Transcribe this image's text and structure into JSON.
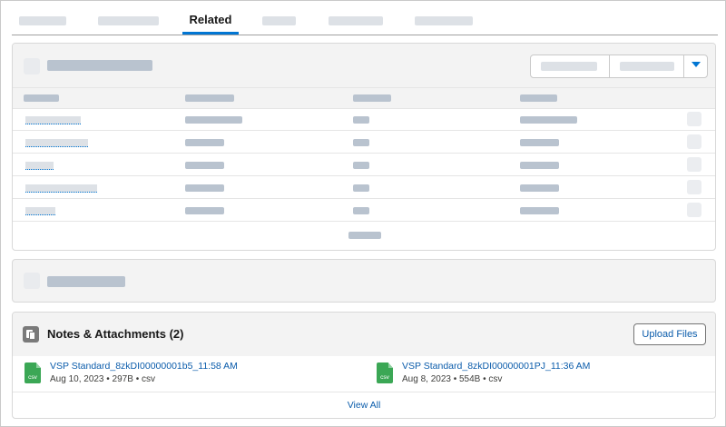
{
  "tabs": {
    "active_label": "Related"
  },
  "notes": {
    "title": "Notes & Attachments (2)",
    "upload_label": "Upload Files",
    "view_all_label": "View All",
    "files": [
      {
        "name": "VSP Standard_8zkDI00000001b5_11:58 AM",
        "meta": "Aug 10, 2023 • 297B • csv",
        "ext": "csv"
      },
      {
        "name": "VSP Standard_8zkDI00000001PJ_11:36 AM",
        "meta": "Aug 8, 2023 • 554B • csv",
        "ext": "csv"
      }
    ]
  },
  "icons": {
    "notes_icon": "notes-attachments-icon",
    "file_icon": "csv-file-icon",
    "dropdown_icon": "chevron-down-icon"
  },
  "colors": {
    "accent": "#0176d3",
    "link": "#0b5cab",
    "file_green": "#3ba755",
    "placeholder": "#dde1e6"
  }
}
